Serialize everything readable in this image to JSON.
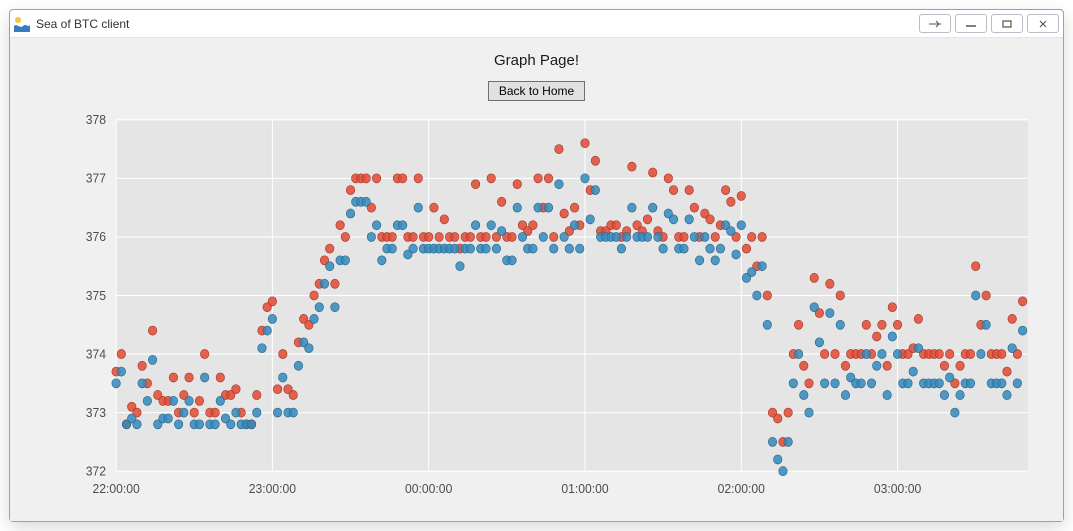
{
  "window": {
    "title": "Sea of BTC client"
  },
  "page": {
    "heading": "Graph Page!",
    "back_label": "Back to Home"
  },
  "chart_data": {
    "type": "scatter",
    "title": "",
    "xlabel": "",
    "ylabel": "",
    "ylim": [
      372,
      378
    ],
    "xlim": [
      "22:00:00",
      "03:50:00"
    ],
    "x_ticks": [
      "22:00:00",
      "23:00:00",
      "00:00:00",
      "01:00:00",
      "02:00:00",
      "03:00:00"
    ],
    "y_ticks": [
      372,
      373,
      374,
      375,
      376,
      377,
      378
    ],
    "x_unit": "time_hh:mm:ss",
    "x": [
      "22:00",
      "22:02",
      "22:04",
      "22:06",
      "22:08",
      "22:10",
      "22:12",
      "22:14",
      "22:16",
      "22:18",
      "22:20",
      "22:22",
      "22:24",
      "22:26",
      "22:28",
      "22:30",
      "22:32",
      "22:34",
      "22:36",
      "22:38",
      "22:40",
      "22:42",
      "22:44",
      "22:46",
      "22:48",
      "22:50",
      "22:52",
      "22:54",
      "22:56",
      "22:58",
      "23:00",
      "23:02",
      "23:04",
      "23:06",
      "23:08",
      "23:10",
      "23:12",
      "23:14",
      "23:16",
      "23:18",
      "23:20",
      "23:22",
      "23:24",
      "23:26",
      "23:28",
      "23:30",
      "23:32",
      "23:34",
      "23:36",
      "23:38",
      "23:40",
      "23:42",
      "23:44",
      "23:46",
      "23:48",
      "23:50",
      "23:52",
      "23:54",
      "23:56",
      "23:58",
      "00:00",
      "00:02",
      "00:04",
      "00:06",
      "00:08",
      "00:10",
      "00:12",
      "00:14",
      "00:16",
      "00:18",
      "00:20",
      "00:22",
      "00:24",
      "00:26",
      "00:28",
      "00:30",
      "00:32",
      "00:34",
      "00:36",
      "00:38",
      "00:40",
      "00:42",
      "00:44",
      "00:46",
      "00:48",
      "00:50",
      "00:52",
      "00:54",
      "00:56",
      "00:58",
      "01:00",
      "01:02",
      "01:04",
      "01:06",
      "01:08",
      "01:10",
      "01:12",
      "01:14",
      "01:16",
      "01:18",
      "01:20",
      "01:22",
      "01:24",
      "01:26",
      "01:28",
      "01:30",
      "01:32",
      "01:34",
      "01:36",
      "01:38",
      "01:40",
      "01:42",
      "01:44",
      "01:46",
      "01:48",
      "01:50",
      "01:52",
      "01:54",
      "01:56",
      "01:58",
      "02:00",
      "02:02",
      "02:04",
      "02:06",
      "02:08",
      "02:10",
      "02:12",
      "02:14",
      "02:16",
      "02:18",
      "02:20",
      "02:22",
      "02:24",
      "02:26",
      "02:28",
      "02:30",
      "02:32",
      "02:34",
      "02:36",
      "02:38",
      "02:40",
      "02:42",
      "02:44",
      "02:46",
      "02:48",
      "02:50",
      "02:52",
      "02:54",
      "02:56",
      "02:58",
      "03:00",
      "03:02",
      "03:04",
      "03:06",
      "03:08",
      "03:10",
      "03:12",
      "03:14",
      "03:16",
      "03:18",
      "03:20",
      "03:22",
      "03:24",
      "03:26",
      "03:28",
      "03:30",
      "03:32",
      "03:34",
      "03:36",
      "03:38",
      "03:40",
      "03:42",
      "03:44",
      "03:46",
      "03:48"
    ],
    "series": [
      {
        "name": "series1_red",
        "color": "#E24A33",
        "values": [
          373.7,
          374.0,
          372.8,
          373.1,
          373.0,
          373.8,
          373.5,
          374.4,
          373.3,
          373.2,
          373.2,
          373.6,
          373.0,
          373.3,
          373.6,
          373.0,
          373.2,
          374.0,
          373.0,
          373.0,
          373.6,
          373.3,
          373.3,
          373.4,
          373.0,
          372.8,
          372.8,
          373.3,
          374.4,
          374.8,
          374.9,
          373.4,
          374.0,
          373.4,
          373.3,
          374.2,
          374.6,
          374.5,
          375.0,
          375.2,
          375.6,
          375.8,
          375.2,
          376.2,
          376.0,
          376.8,
          377.0,
          377.0,
          377.0,
          376.5,
          377.0,
          376.0,
          376.0,
          376.0,
          377.0,
          377.0,
          376.0,
          376.0,
          377.0,
          376.0,
          376.0,
          376.5,
          376.0,
          376.3,
          376.0,
          376.0,
          375.8,
          376.0,
          376.0,
          376.9,
          376.0,
          376.0,
          377.0,
          376.0,
          376.6,
          376.0,
          376.0,
          376.9,
          376.2,
          376.1,
          376.2,
          377.0,
          376.5,
          377.0,
          376.0,
          377.5,
          376.4,
          376.1,
          376.5,
          376.2,
          377.6,
          376.8,
          377.3,
          376.1,
          376.1,
          376.2,
          376.2,
          376.0,
          376.1,
          377.2,
          376.2,
          376.1,
          376.3,
          377.1,
          376.1,
          376.0,
          377.0,
          376.8,
          376.0,
          376.0,
          376.8,
          376.5,
          376.0,
          376.4,
          376.3,
          376.0,
          376.2,
          376.8,
          376.6,
          376.0,
          376.7,
          375.8,
          376.0,
          375.5,
          376.0,
          375.0,
          373.0,
          372.9,
          372.5,
          373.0,
          374.0,
          374.5,
          373.8,
          373.5,
          375.3,
          374.7,
          374.0,
          375.2,
          374.0,
          375.0,
          373.8,
          374.0,
          374.0,
          374.0,
          374.5,
          374.0,
          374.3,
          374.5,
          373.8,
          374.8,
          374.5,
          374.0,
          374.0,
          374.1,
          374.6,
          374.0,
          374.0,
          374.0,
          374.0,
          373.8,
          374.0,
          373.5,
          373.8,
          374.0,
          374.0,
          375.5,
          374.5,
          375.0,
          374.0,
          374.0,
          374.0,
          373.7,
          374.6,
          374.0,
          374.9
        ]
      },
      {
        "name": "series2_blue",
        "color": "#348ABD",
        "values": [
          373.5,
          373.7,
          372.8,
          372.9,
          372.8,
          373.5,
          373.2,
          373.9,
          372.8,
          372.9,
          372.9,
          373.2,
          372.8,
          373.0,
          373.2,
          372.8,
          372.8,
          373.6,
          372.8,
          372.8,
          373.2,
          372.9,
          372.8,
          373.0,
          372.8,
          372.8,
          372.8,
          373.0,
          374.1,
          374.4,
          374.6,
          373.0,
          373.6,
          373.0,
          373.0,
          373.8,
          374.2,
          374.1,
          374.6,
          374.8,
          375.2,
          375.5,
          374.8,
          375.6,
          375.6,
          376.4,
          376.6,
          376.6,
          376.6,
          376.0,
          376.2,
          375.6,
          375.8,
          375.8,
          376.2,
          376.2,
          375.7,
          375.8,
          376.5,
          375.8,
          375.8,
          375.8,
          375.8,
          375.8,
          375.8,
          375.8,
          375.5,
          375.8,
          375.8,
          376.2,
          375.8,
          375.8,
          376.2,
          375.8,
          376.1,
          375.6,
          375.6,
          376.5,
          376.0,
          375.8,
          375.8,
          376.5,
          376.0,
          376.5,
          375.8,
          376.9,
          376.0,
          375.8,
          376.2,
          375.8,
          377.0,
          376.3,
          376.8,
          376.0,
          376.0,
          376.0,
          376.0,
          375.8,
          376.0,
          376.5,
          376.0,
          376.0,
          376.0,
          376.5,
          376.0,
          375.8,
          376.4,
          376.3,
          375.8,
          375.8,
          376.3,
          376.0,
          375.6,
          376.0,
          375.8,
          375.6,
          375.8,
          376.2,
          376.1,
          375.7,
          376.2,
          375.3,
          375.4,
          375.0,
          375.5,
          374.5,
          372.5,
          372.2,
          372.0,
          372.5,
          373.5,
          374.0,
          373.3,
          373.0,
          374.8,
          374.2,
          373.5,
          374.7,
          373.5,
          374.5,
          373.3,
          373.6,
          373.5,
          373.5,
          374.0,
          373.5,
          373.8,
          374.0,
          373.3,
          374.3,
          374.0,
          373.5,
          373.5,
          373.7,
          374.1,
          373.5,
          373.5,
          373.5,
          373.5,
          373.3,
          373.6,
          373.0,
          373.3,
          373.5,
          373.5,
          375.0,
          374.0,
          374.5,
          373.5,
          373.5,
          373.5,
          373.3,
          374.1,
          373.5,
          374.4
        ]
      }
    ]
  }
}
